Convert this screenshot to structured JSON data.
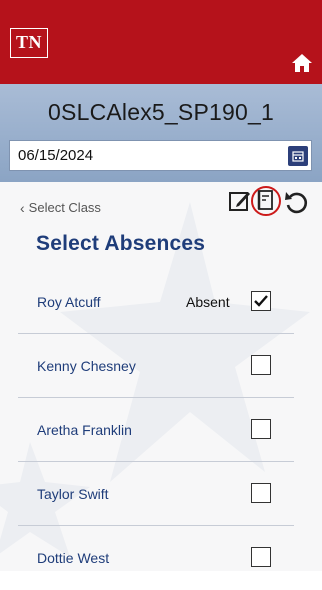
{
  "header": {
    "logo_text": "TN",
    "home_icon": "home-icon",
    "brand_color": "#b5121b"
  },
  "class_bar": {
    "class_name": "0SLCAlex5_SP190_1",
    "date_value": "06/15/2024",
    "calendar_icon": "calendar-icon"
  },
  "toolbar": {
    "back_label": "Select Class",
    "back_icon": "chevron-left-icon",
    "edit_icon": "edit-icon",
    "form_icon": "notepad-icon",
    "refresh_icon": "refresh-icon",
    "highlight_color": "#cc1a1a"
  },
  "main": {
    "heading": "Select Absences",
    "students": [
      {
        "name": "Roy Atcuff",
        "status": "Absent",
        "checked": true
      },
      {
        "name": "Kenny Chesney",
        "status": "",
        "checked": false
      },
      {
        "name": "Aretha Franklin",
        "status": "",
        "checked": false
      },
      {
        "name": "Taylor Swift",
        "status": "",
        "checked": false
      },
      {
        "name": "Dottie West",
        "status": "",
        "checked": false
      }
    ]
  }
}
